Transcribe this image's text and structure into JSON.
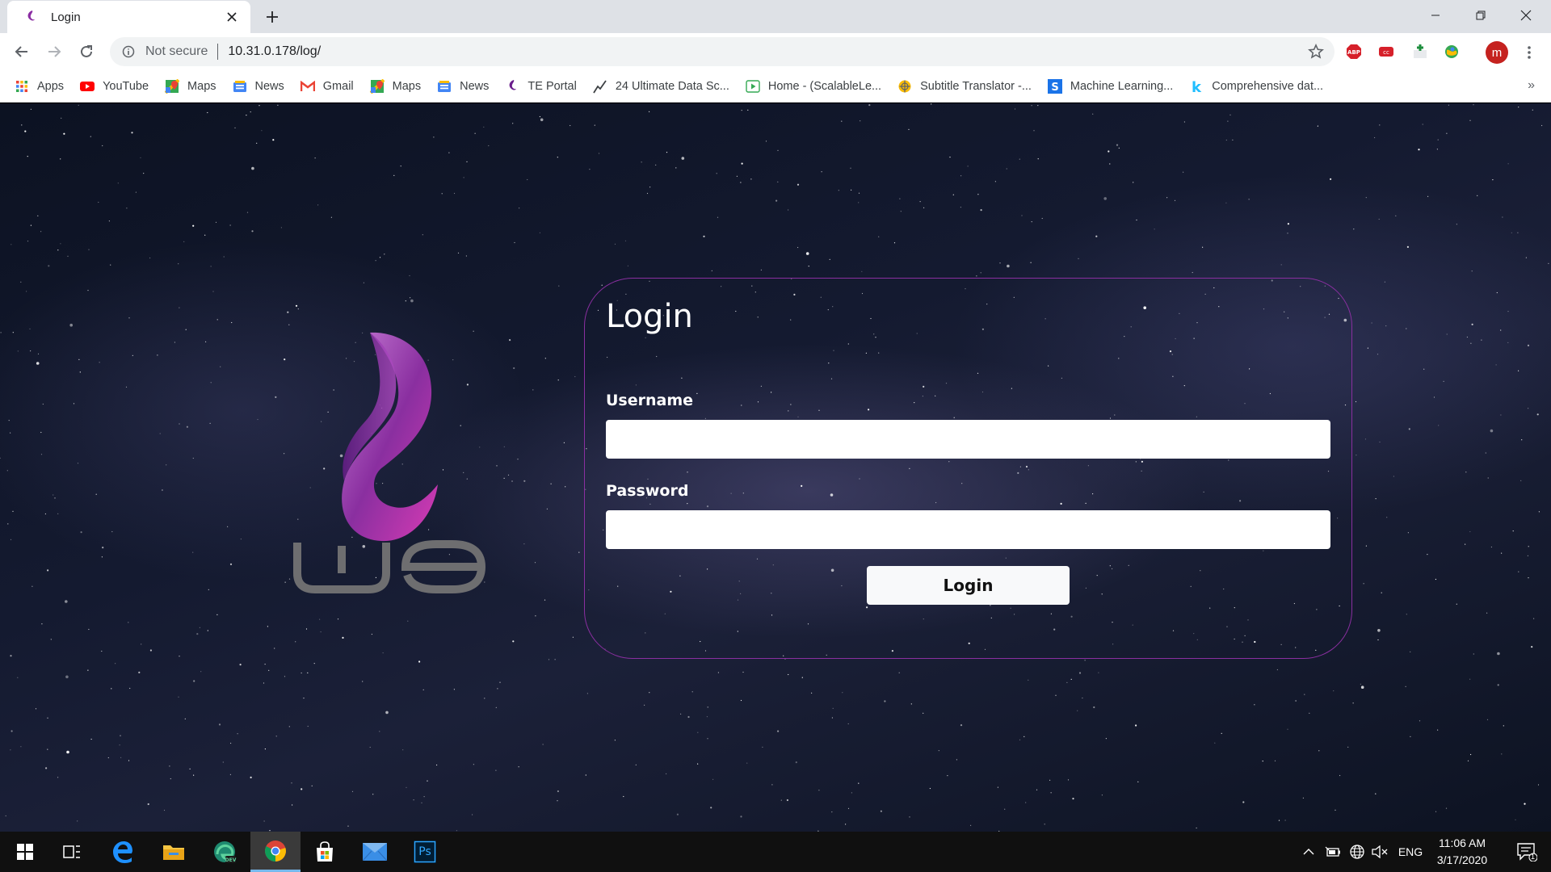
{
  "browser": {
    "tab": {
      "title": "Login"
    },
    "address": {
      "security_label": "Not secure",
      "url": "10.31.0.178/log/"
    },
    "avatar_initial": "m",
    "bookmarks": [
      {
        "label": "Apps",
        "icon": "apps-grid-icon"
      },
      {
        "label": "YouTube",
        "icon": "youtube-icon"
      },
      {
        "label": "Maps",
        "icon": "maps-icon"
      },
      {
        "label": "News",
        "icon": "news-icon"
      },
      {
        "label": "Gmail",
        "icon": "gmail-icon"
      },
      {
        "label": "Maps",
        "icon": "maps-icon"
      },
      {
        "label": "News",
        "icon": "news-icon"
      },
      {
        "label": "TE Portal",
        "icon": "te-portal-icon"
      },
      {
        "label": "24 Ultimate Data Sc...",
        "icon": "chart-line-icon"
      },
      {
        "label": "Home - (ScalableLe...",
        "icon": "play-icon"
      },
      {
        "label": "Subtitle Translator -...",
        "icon": "translator-icon"
      },
      {
        "label": "Machine Learning...",
        "icon": "s-icon"
      },
      {
        "label": "Comprehensive dat...",
        "icon": "k-icon"
      }
    ],
    "more_label": "»"
  },
  "login": {
    "title": "Login",
    "username_label": "Username",
    "password_label": "Password",
    "username_value": "",
    "password_value": "",
    "button_label": "Login"
  },
  "logo": {
    "text": "we",
    "colors": {
      "purple_light": "#c77dd6",
      "purple_dark": "#6a1d8c",
      "magenta": "#d63bb4",
      "grey": "#6e6e70"
    }
  },
  "taskbar": {
    "apps": [
      "windows-start-icon",
      "task-view-icon",
      "edge-legacy-icon",
      "file-explorer-icon",
      "edge-dev-icon",
      "chrome-icon",
      "store-icon",
      "mail-icon",
      "photoshop-icon"
    ],
    "photoshop_label": "Ps",
    "language": "ENG",
    "time": "11:06 AM",
    "date": "3/17/2020",
    "notification_count": "1"
  },
  "colors": {
    "card_border": "#8a2fa0",
    "tab_bar": "#dee1e6",
    "taskbar": "#101010",
    "accent": "#76b9ed"
  }
}
